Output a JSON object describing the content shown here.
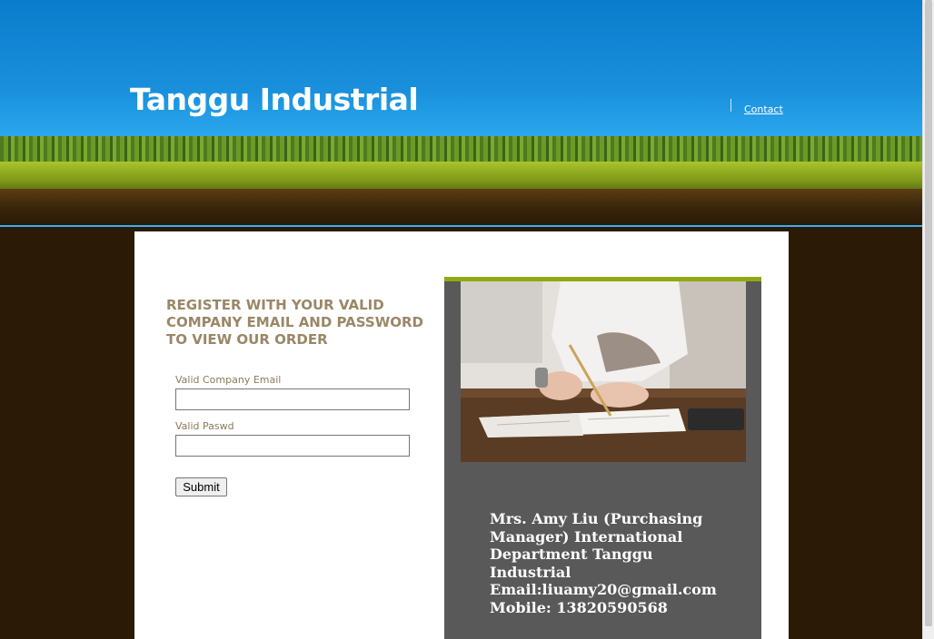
{
  "header": {
    "site_title": "Tanggu Industrial",
    "nav": [
      {
        "label": "Contact"
      }
    ]
  },
  "form": {
    "heading": "REGISTER WITH YOUR VALID COMPANY EMAIL AND PASSWORD TO VIEW OUR ORDER",
    "email_label": "Valid Company Email",
    "email_value": "",
    "password_label": "Valid Paswd",
    "password_value": "",
    "submit_label": "Submit"
  },
  "contact_card": {
    "lines": [
      "Mrs. Amy Liu (Purchasing Manager) International Department Tanggu Industrial",
      "Email:liuamy20@gmail.com",
      "Mobile: 13820590568"
    ]
  },
  "colors": {
    "sky": "#1a90dc",
    "grass": "#7f9a1a",
    "soil": "#2a1a06",
    "heading_text": "#9a8766",
    "card_bg": "#595959",
    "card_accent": "#8fa913"
  }
}
